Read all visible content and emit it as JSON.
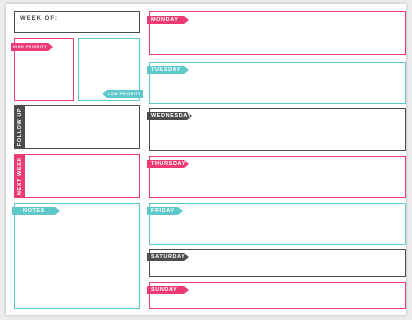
{
  "week_of": {
    "label": "WEEK OF:"
  },
  "priorities": {
    "high": "HIGH PRIORITY",
    "low": "LOW PRIORITY"
  },
  "sections": {
    "follow_up": "FOLLOW UP",
    "next_week": "NEXT WEEK",
    "notes": "NOTES"
  },
  "days": [
    "MONDAY",
    "TUESDAY",
    "WEDNESDAY",
    "THURSDAY",
    "FRIDAY",
    "SATURDAY",
    "SUNDAY"
  ],
  "colors": {
    "pink": "#ee3a73",
    "teal": "#5ec8cb",
    "dark": "#4c4c4c"
  }
}
